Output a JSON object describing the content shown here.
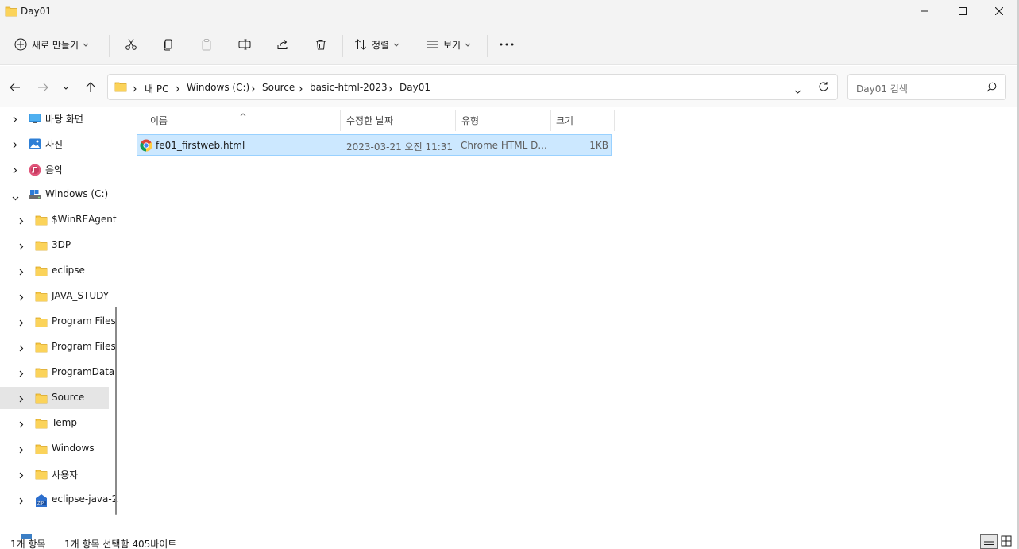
{
  "window": {
    "title": "Day01"
  },
  "commandbar": {
    "new_label": "새로 만들기",
    "sort_label": "정렬",
    "view_label": "보기",
    "more_label": "···"
  },
  "address": {
    "crumbs": [
      "내 PC",
      "Windows (C:)",
      "Source",
      "basic-html-2023",
      "Day01"
    ]
  },
  "search": {
    "placeholder": "Day01 검색"
  },
  "sidebar": {
    "items": [
      {
        "label": "바탕 화면",
        "icon": "desktop-icon"
      },
      {
        "label": "사진",
        "icon": "pictures-icon"
      },
      {
        "label": "음악",
        "icon": "music-icon"
      },
      {
        "label": "Windows (C:)",
        "icon": "drive-icon",
        "expanded": true
      },
      {
        "label": "$WinREAgent",
        "icon": "folder-icon"
      },
      {
        "label": "3DP",
        "icon": "folder-icon"
      },
      {
        "label": "eclipse",
        "icon": "folder-icon"
      },
      {
        "label": "JAVA_STUDY",
        "icon": "folder-icon"
      },
      {
        "label": "Program Files",
        "icon": "folder-icon"
      },
      {
        "label": "Program Files",
        "icon": "folder-icon"
      },
      {
        "label": "ProgramData",
        "icon": "folder-icon"
      },
      {
        "label": "Source",
        "icon": "folder-icon",
        "selected": true
      },
      {
        "label": "Temp",
        "icon": "folder-icon"
      },
      {
        "label": "Windows",
        "icon": "folder-icon"
      },
      {
        "label": "사용자",
        "icon": "folder-icon"
      },
      {
        "label": "eclipse-java-2",
        "icon": "zip-icon"
      }
    ]
  },
  "columns": {
    "name": "이름",
    "modified": "수정한 날짜",
    "type": "유형",
    "size": "크기"
  },
  "files": [
    {
      "name": "fe01_firstweb.html",
      "modified": "2023-03-21 오전 11:31",
      "type": "Chrome HTML D...",
      "size": "1KB",
      "selected": true
    }
  ],
  "status": {
    "count": "1개 항목",
    "selection": "1개 항목 선택함 405바이트"
  },
  "colors": {
    "selection": "#cce8ff",
    "folder": "#f8c948",
    "accent": "#0067c0"
  }
}
